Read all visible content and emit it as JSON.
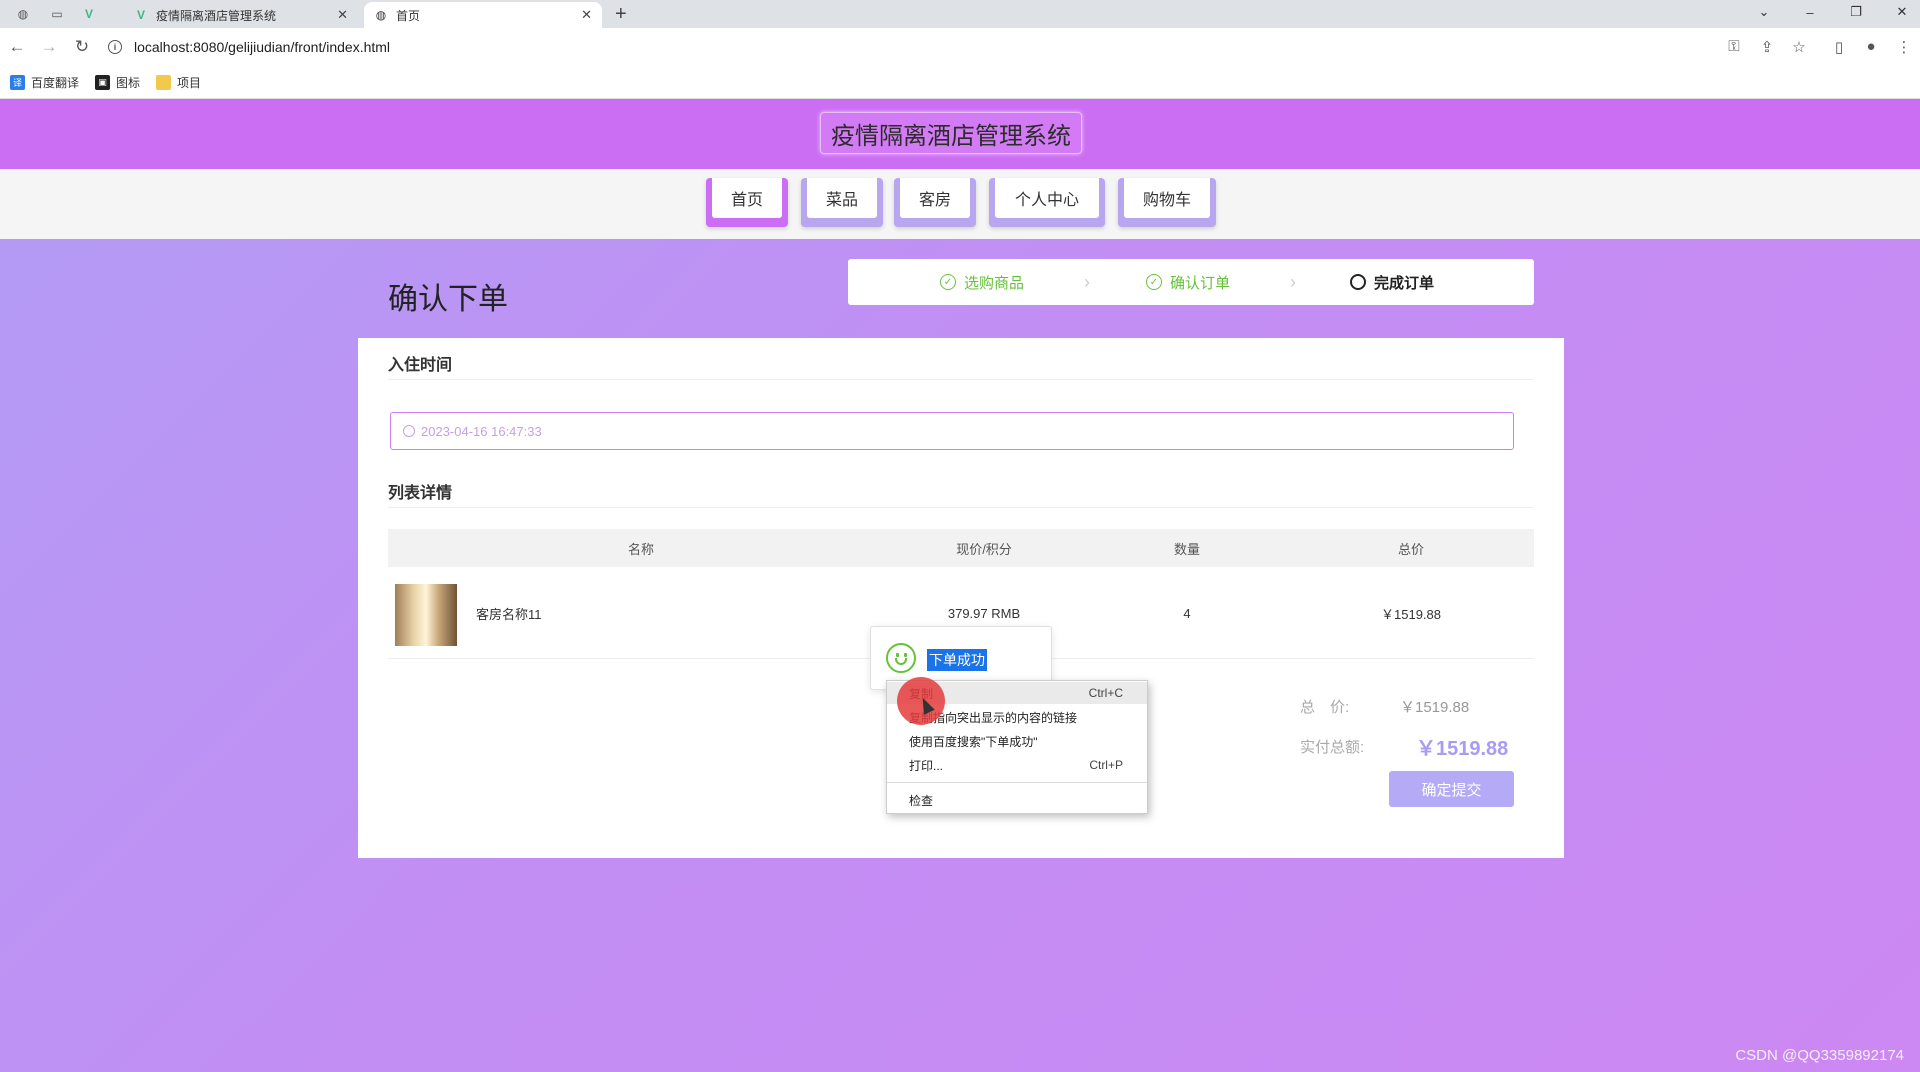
{
  "browser": {
    "tabs": [
      {
        "label": "疫情隔离酒店管理系统",
        "icon": "vue-logo-icon"
      },
      {
        "label": "首页",
        "icon": "globe-icon",
        "active": true
      }
    ],
    "url": "localhost:8080/gelijiudian/front/index.html",
    "bookmarks": [
      {
        "label": "百度翻译",
        "icon": "translate-icon"
      },
      {
        "label": "图标",
        "icon": "image-icon"
      },
      {
        "label": "项目",
        "icon": "folder-icon"
      }
    ]
  },
  "site": {
    "title": "疫情隔离酒店管理系统",
    "nav": [
      {
        "label": "首页",
        "active": true
      },
      {
        "label": "菜品"
      },
      {
        "label": "客房"
      },
      {
        "label": "个人中心"
      },
      {
        "label": "购物车"
      }
    ]
  },
  "order": {
    "heading": "确认下单",
    "steps": [
      {
        "label": "选购商品",
        "status": "done"
      },
      {
        "label": "确认订单",
        "status": "done"
      },
      {
        "label": "完成订单",
        "status": "current"
      }
    ],
    "checkin_label": "入住时间",
    "checkin_value": "2023-04-16 16:47:33",
    "list_label": "列表详情",
    "columns": [
      "名称",
      "现价/积分",
      "数量",
      "总价"
    ],
    "rows": [
      {
        "name": "客房名称11",
        "price": "379.97 RMB",
        "qty": "4",
        "total": "￥1519.88"
      }
    ],
    "total_label": "总　价:",
    "total_value": "￥1519.88",
    "paid_label": "实付总额:",
    "paid_value": "￥1519.88",
    "submit_label": "确定提交"
  },
  "toast": {
    "message": "下单成功"
  },
  "context_menu": [
    {
      "label": "复制",
      "shortcut": "Ctrl+C"
    },
    {
      "label": "复制指向突出显示的内容的链接",
      "shortcut": ""
    },
    {
      "label": "使用百度搜索\"下单成功\"",
      "shortcut": ""
    },
    {
      "label": "打印...",
      "shortcut": "Ctrl+P"
    },
    {
      "label": "检查",
      "shortcut": ""
    }
  ],
  "watermark": "CSDN @QQ3359892174",
  "colors": {
    "header": "#cc6ef4",
    "accent": "#b5aaf5",
    "success": "#67c23a"
  }
}
